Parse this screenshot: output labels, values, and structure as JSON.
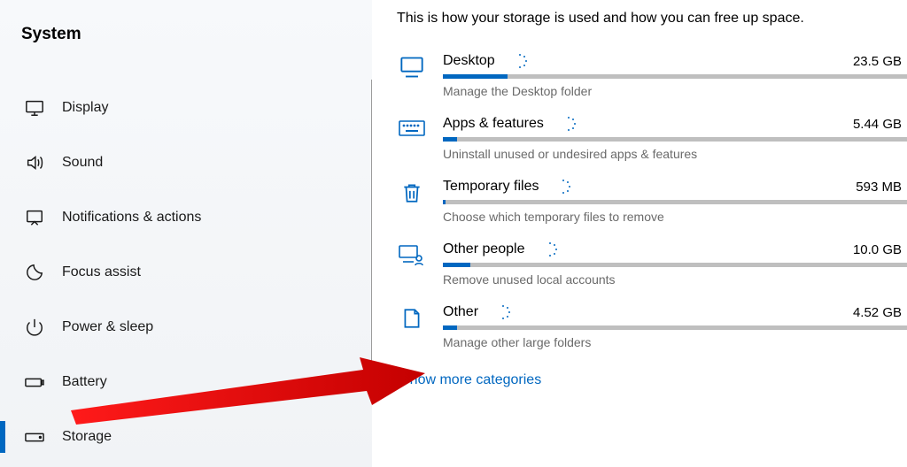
{
  "sidebar": {
    "title": "System",
    "items": [
      {
        "label": "Display",
        "icon": "display-icon",
        "selected": false
      },
      {
        "label": "Sound",
        "icon": "sound-icon",
        "selected": false
      },
      {
        "label": "Notifications & actions",
        "icon": "notifications-icon",
        "selected": false
      },
      {
        "label": "Focus assist",
        "icon": "focus-icon",
        "selected": false
      },
      {
        "label": "Power & sleep",
        "icon": "power-icon",
        "selected": false
      },
      {
        "label": "Battery",
        "icon": "battery-icon",
        "selected": false
      },
      {
        "label": "Storage",
        "icon": "storage-icon",
        "selected": true
      }
    ]
  },
  "main": {
    "intro": "This is how your storage is used and how you can free up space.",
    "categories": [
      {
        "title": "Desktop",
        "size": "23.5 GB",
        "sub": "Manage the Desktop folder",
        "fill": 14,
        "icon": "monitor-icon"
      },
      {
        "title": "Apps & features",
        "size": "5.44 GB",
        "sub": "Uninstall unused or undesired apps & features",
        "fill": 3,
        "icon": "keyboard-icon"
      },
      {
        "title": "Temporary files",
        "size": "593 MB",
        "sub": "Choose which temporary files to remove",
        "fill": 0.5,
        "icon": "trash-icon"
      },
      {
        "title": "Other people",
        "size": "10.0 GB",
        "sub": "Remove unused local accounts",
        "fill": 6,
        "icon": "people-icon"
      },
      {
        "title": "Other",
        "size": "4.52 GB",
        "sub": "Manage other large folders",
        "fill": 3,
        "icon": "folder-icon"
      }
    ],
    "show_more": "Show more categories"
  },
  "colors": {
    "accent": "#0067c0"
  }
}
